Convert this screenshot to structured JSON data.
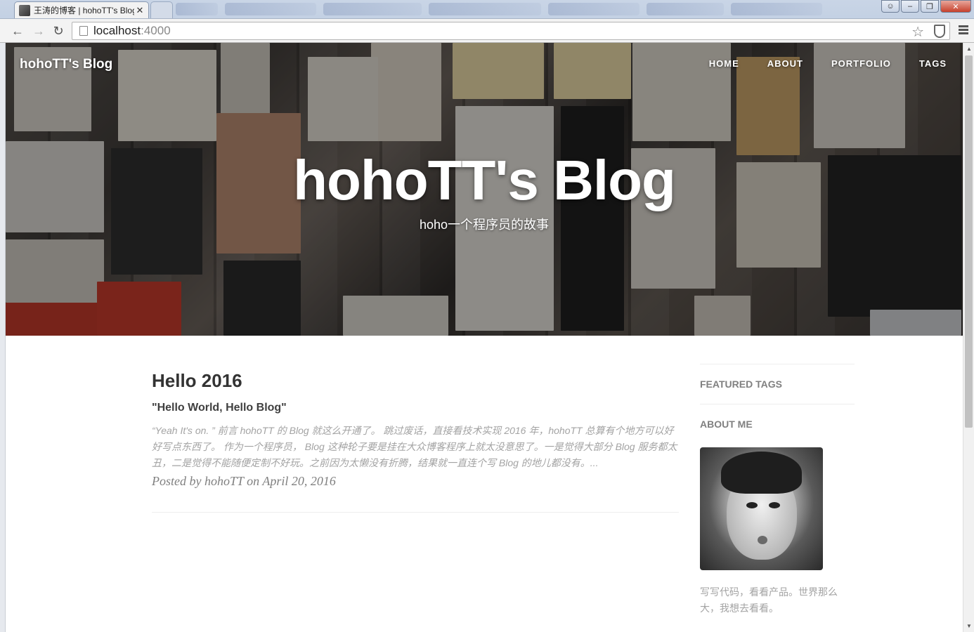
{
  "browser": {
    "active_tab_title": "王涛的博客 | hohoTT's Blog",
    "tab_close": "✕",
    "url_host": "localhost",
    "url_port": ":4000"
  },
  "site": {
    "brand": "hohoTT's Blog",
    "nav": [
      "HOME",
      "ABOUT",
      "PORTFOLIO",
      "TAGS"
    ],
    "hero_title": "hohoTT's Blog",
    "hero_subtitle": "hoho一个程序员的故事"
  },
  "post": {
    "title": "Hello 2016",
    "subtitle": "\"Hello World, Hello Blog\"",
    "excerpt": "“Yeah It's on. ” 前言 hohoTT 的 Blog 就这么开通了。 跳过废话，直接看技术实现 2016 年，hohoTT 总算有个地方可以好好写点东西了。 作为一个程序员， Blog 这种轮子要是挂在大众博客程序上就太没意思了。一是觉得大部分 Blog 服务都太丑，二是觉得不能随便定制不好玩。之前因为太懒没有折腾，结果就一直连个写 Blog 的地儿都没有。...",
    "meta": "Posted by hohoTT on April 20, 2016"
  },
  "sidebar": {
    "featured_tags_heading": "FEATURED TAGS",
    "about_heading": "ABOUT ME",
    "about_text": "写写代码，看看产品。世界那么大，我想去看看。"
  },
  "icons": [
    "back-icon",
    "forward-icon",
    "reload-icon",
    "page-icon",
    "star-icon",
    "shield-icon",
    "menu-icon"
  ]
}
